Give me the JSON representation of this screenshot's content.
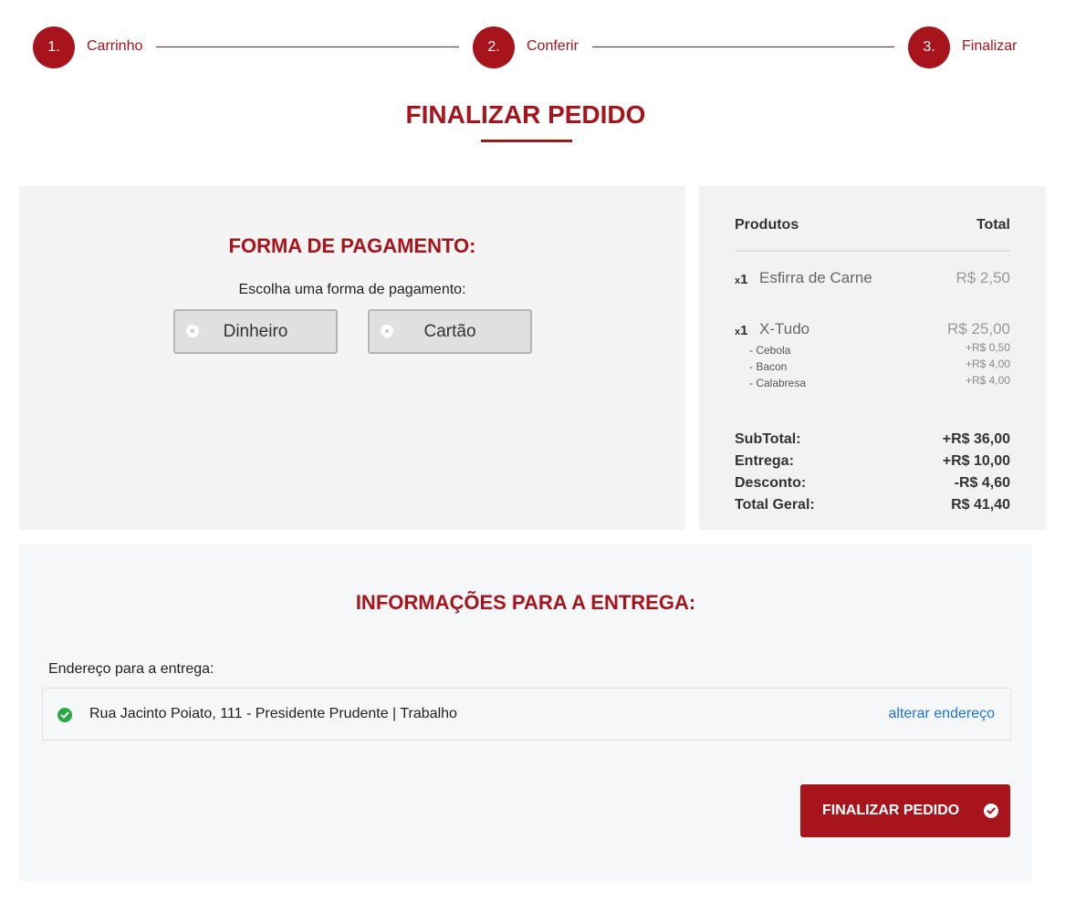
{
  "stepper": {
    "steps": [
      {
        "number": "1.",
        "label": "Carrinho"
      },
      {
        "number": "2.",
        "label": "Conferir"
      },
      {
        "number": "3.",
        "label": "Finalizar"
      }
    ]
  },
  "page_title": "FINALIZAR PEDIDO",
  "payment": {
    "heading": "FORMA DE PAGAMENTO:",
    "subtitle": "Escolha uma forma de pagamento:",
    "options": [
      "Dinheiro",
      "Cartão"
    ]
  },
  "summary": {
    "col_products": "Produtos",
    "col_total": "Total",
    "items": [
      {
        "qty_prefix": "x",
        "qty": "1",
        "name": "Esfirra de Carne",
        "price": "R$ 2,50",
        "addons": []
      },
      {
        "qty_prefix": "x",
        "qty": "1",
        "name": "X-Tudo",
        "price": "R$ 25,00",
        "addons": [
          {
            "name": "- Cebola",
            "price": "+R$ 0,50"
          },
          {
            "name": "- Bacon",
            "price": "+R$ 4,00"
          },
          {
            "name": "- Calabresa",
            "price": "+R$ 4,00"
          }
        ]
      }
    ],
    "totals": [
      {
        "label": "SubTotal:",
        "value": "+R$ 36,00"
      },
      {
        "label": "Entrega:",
        "value": "+R$ 10,00"
      },
      {
        "label": "Desconto:",
        "value": "-R$ 4,60"
      },
      {
        "label": "Total Geral:",
        "value": "R$ 41,40"
      }
    ]
  },
  "delivery": {
    "heading": "INFORMAÇÕES PARA A ENTREGA:",
    "address_label": "Endereço para a entrega:",
    "address": "Rua Jacinto Poiato, 111 - Presidente Prudente | Trabalho",
    "change_link": "alterar endereço"
  },
  "finish_button": "FINALIZAR PEDIDO",
  "colors": {
    "brand": "#a8141b",
    "link": "#1a73d9",
    "success": "#28a745"
  },
  "icons": {
    "address_status": "check-circle-icon",
    "finish_button": "check-circle-icon"
  }
}
